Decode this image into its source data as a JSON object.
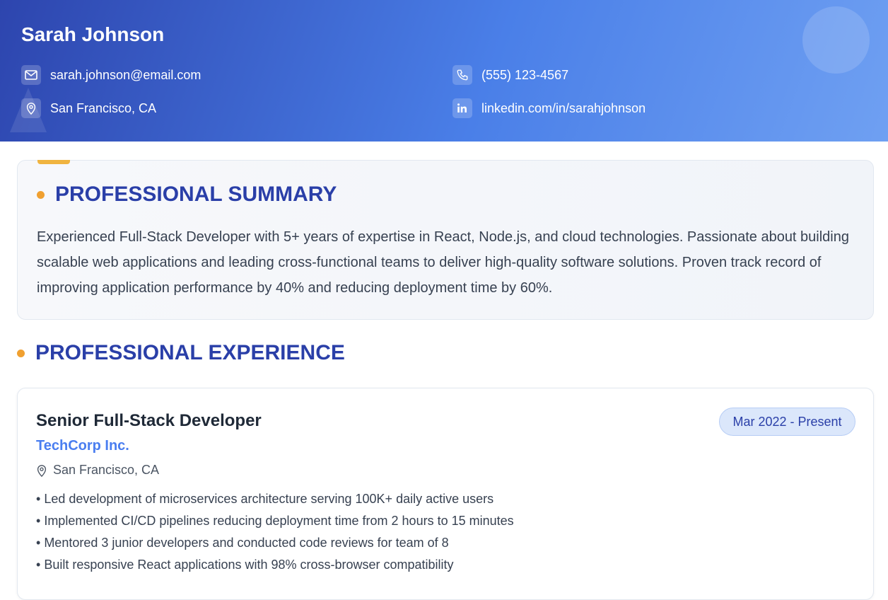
{
  "header": {
    "name": "Sarah Johnson",
    "email": {
      "icon": "mail-icon",
      "text": "sarah.johnson@email.com"
    },
    "phone": {
      "icon": "phone-icon",
      "text": "(555) 123-4567"
    },
    "location": {
      "icon": "map-pin-icon",
      "text": "San Francisco, CA"
    },
    "linkedin": {
      "icon": "linkedin-icon",
      "text": "linkedin.com/in/sarahjohnson"
    }
  },
  "summary": {
    "heading": "PROFESSIONAL SUMMARY",
    "text": "Experienced Full-Stack Developer with 5+ years of expertise in React, Node.js, and cloud technologies. Passionate about building scalable web applications and leading cross-functional teams to deliver high-quality software solutions. Proven track record of improving application performance by 40% and reducing deployment time by 60%."
  },
  "experience": {
    "heading": "PROFESSIONAL EXPERIENCE",
    "jobs": [
      {
        "title": "Senior Full-Stack Developer",
        "company": "TechCorp Inc.",
        "location": "San Francisco, CA",
        "dates": "Mar 2022 - Present",
        "bullets": [
          "Led development of microservices architecture serving 100K+ daily active users",
          "Implemented CI/CD pipelines reducing deployment time from 2 hours to 15 minutes",
          "Mentored 3 junior developers and conducted code reviews for team of 8",
          "Built responsive React applications with 98% cross-browser compatibility"
        ]
      }
    ]
  },
  "colors": {
    "accent": "#2a3fa8",
    "company": "#4a7ef0",
    "dot": "#f0a030"
  }
}
